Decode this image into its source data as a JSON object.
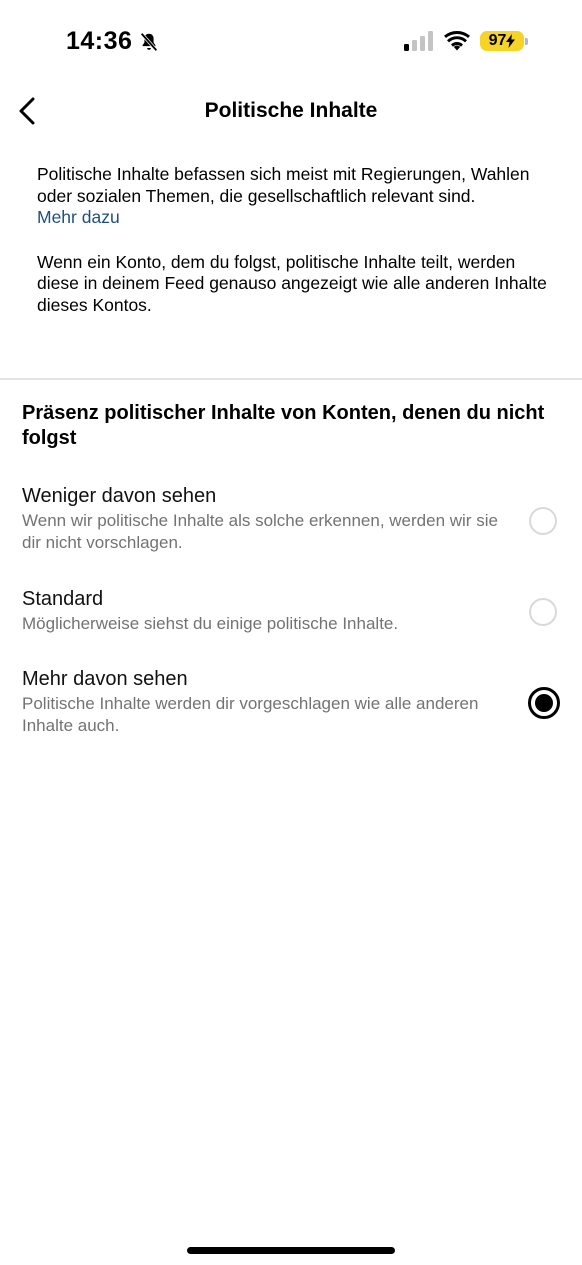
{
  "status_bar": {
    "time": "14:36",
    "battery_level": "97"
  },
  "header": {
    "title": "Politische Inhalte"
  },
  "intro": {
    "paragraph1": "Politische Inhalte befassen sich meist mit Regierungen, Wahlen oder sozialen Themen, die gesellschaftlich relevant sind.",
    "more_link": "Mehr dazu",
    "paragraph2": "Wenn ein Konto, dem du folgst, politische Inhalte teilt, werden diese in deinem Feed genauso angezeigt wie alle anderen Inhalte dieses Kontos."
  },
  "section": {
    "title": "Präsenz politischer Inhalte von Konten, denen du nicht folgst"
  },
  "options": [
    {
      "title": "Weniger davon sehen",
      "description": "Wenn wir politische Inhalte als solche erkennen, werden wir sie dir nicht vorschlagen.",
      "selected": false
    },
    {
      "title": "Standard",
      "description": "Möglicherweise siehst du einige politische Inhalte.",
      "selected": false
    },
    {
      "title": "Mehr davon sehen",
      "description": "Politische Inhalte werden dir vorgeschlagen wie alle anderen Inhalte auch.",
      "selected": true
    }
  ],
  "colors": {
    "link": "#1f4f7f",
    "battery": "#f5d327",
    "secondary_text": "#737373"
  }
}
